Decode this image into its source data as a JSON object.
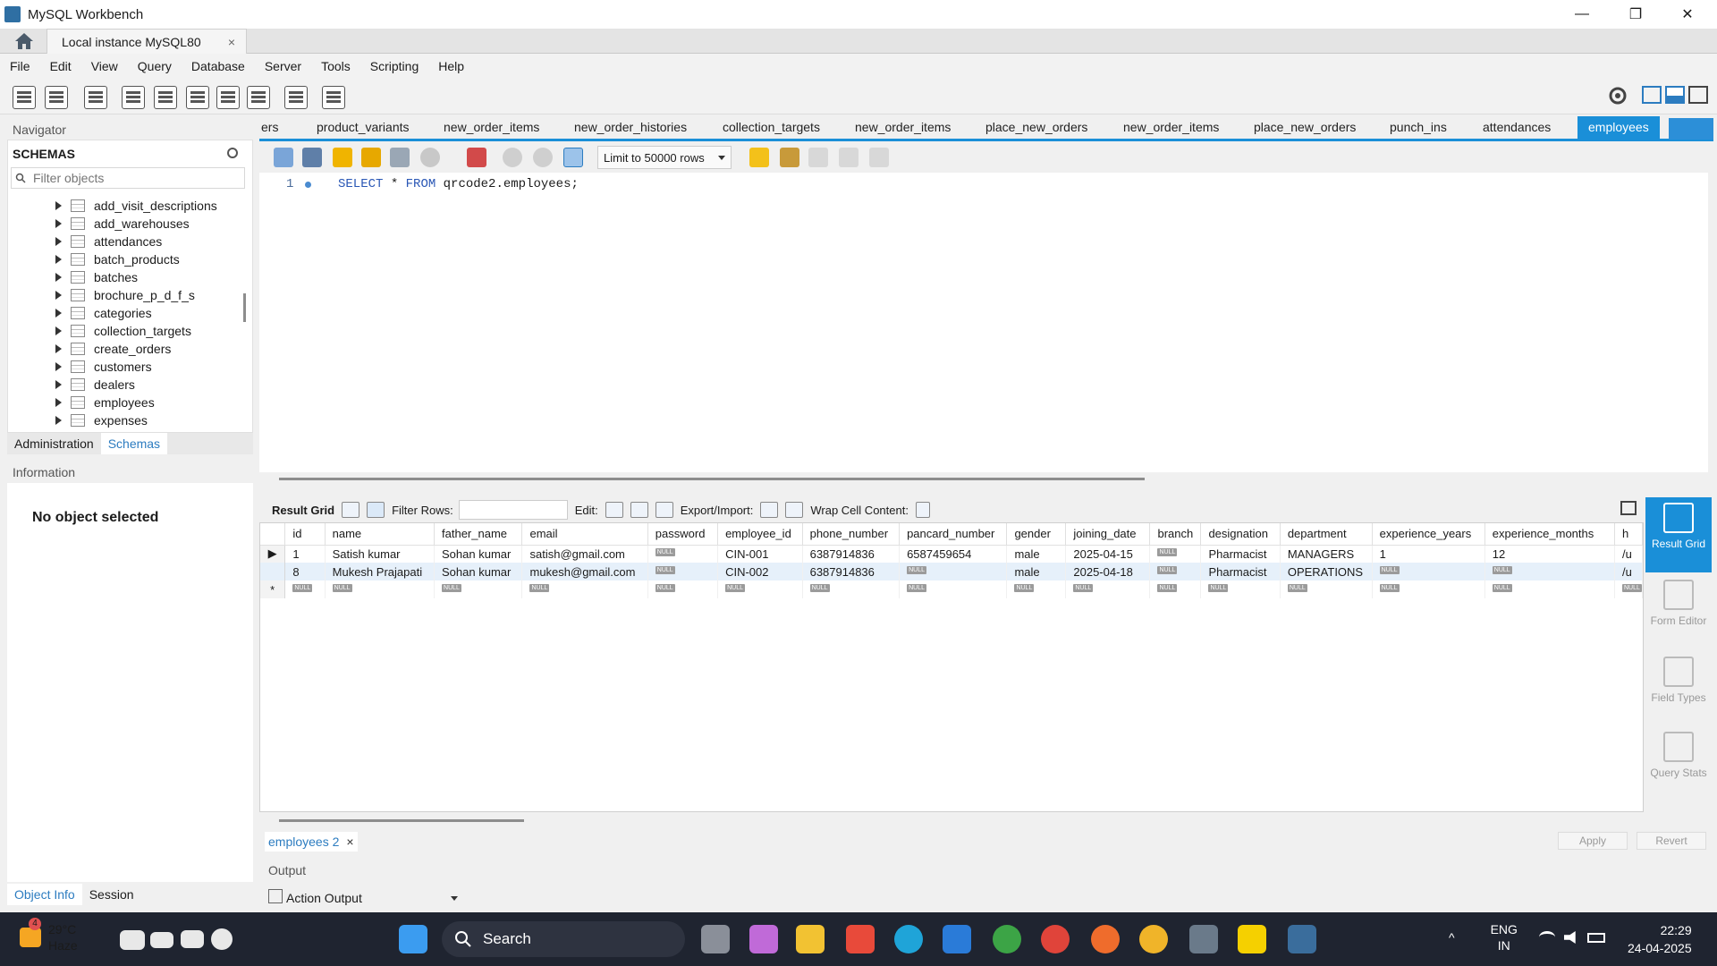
{
  "window": {
    "title": "MySQL Workbench",
    "minimize": "—",
    "maximize": "❐",
    "close": "✕"
  },
  "instance_tab": {
    "label": "Local instance MySQL80",
    "close": "×"
  },
  "menu": [
    "File",
    "Edit",
    "View",
    "Query",
    "Database",
    "Server",
    "Tools",
    "Scripting",
    "Help"
  ],
  "navigator": {
    "title": "Navigator",
    "schemas_label": "SCHEMAS",
    "filter_placeholder": "Filter objects",
    "tables": [
      "add_visit_descriptions",
      "add_warehouses",
      "attendances",
      "batch_products",
      "batches",
      "brochure_p_d_f_s",
      "categories",
      "collection_targets",
      "create_orders",
      "customers",
      "dealers",
      "employees",
      "expenses"
    ],
    "tabs": [
      "Administration",
      "Schemas"
    ],
    "info_title": "Information",
    "no_object": "No object selected",
    "bottom_tabs": [
      "Object Info",
      "Session"
    ]
  },
  "query_tabs": [
    "ers",
    "product_variants",
    "new_order_items",
    "new_order_histories",
    "collection_targets",
    "new_order_items",
    "place_new_orders",
    "new_order_items",
    "place_new_orders",
    "punch_ins",
    "attendances",
    "employees"
  ],
  "editor": {
    "limit_label": "Limit to 50000 rows",
    "line_number": "1",
    "sql_keyword1": "SELECT",
    "sql_mid": " * ",
    "sql_keyword2": "FROM",
    "sql_rest": " qrcode2.employees;"
  },
  "result_toolbar": {
    "result_grid": "Result Grid",
    "filter_rows": "Filter Rows:",
    "edit": "Edit:",
    "export_import": "Export/Import:",
    "wrap": "Wrap Cell Content:"
  },
  "grid": {
    "columns": [
      "id",
      "name",
      "father_name",
      "email",
      "password",
      "employee_id",
      "phone_number",
      "pancard_number",
      "gender",
      "joining_date",
      "branch",
      "designation",
      "department",
      "experience_years",
      "experience_months",
      "h"
    ],
    "rows": [
      [
        "1",
        "Satish kumar",
        "Sohan kumar",
        "satish@gmail.com",
        "NULL",
        "CIN-001",
        "6387914836",
        "6587459654",
        "male",
        "2025-04-15",
        "NULL",
        "Pharmacist",
        "MANAGERS",
        "1",
        "12",
        "/u"
      ],
      [
        "8",
        "Mukesh Prajapati",
        "Sohan kumar",
        "mukesh@gmail.com",
        "NULL",
        "CIN-002",
        "6387914836",
        "NULL",
        "male",
        "2025-04-18",
        "NULL",
        "Pharmacist",
        "OPERATIONS",
        "NULL",
        "NULL",
        "/u"
      ]
    ],
    "null_text": "NULL"
  },
  "side_panel": [
    "Result Grid",
    "Form Editor",
    "Field Types",
    "Query Stats"
  ],
  "result_tab": {
    "label": "employees 2",
    "close": "×"
  },
  "buttons": {
    "apply": "Apply",
    "revert": "Revert"
  },
  "output": {
    "title": "Output",
    "selector": "Action Output"
  },
  "taskbar": {
    "weather_badge": "4",
    "temp": "29°C",
    "condition": "Haze",
    "search": "Search",
    "lang1": "ENG",
    "lang2": "IN",
    "time": "22:29",
    "date": "24-04-2025"
  }
}
